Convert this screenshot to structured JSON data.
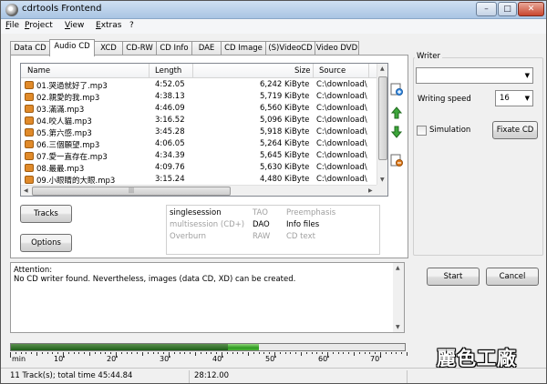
{
  "window": {
    "title": "cdrtools Frontend"
  },
  "menu": [
    "File",
    "Project",
    "View",
    "Extras",
    "?"
  ],
  "tabs": [
    "Data CD",
    "Audio CD",
    "XCD",
    "CD-RW",
    "CD Info",
    "DAE",
    "CD Image",
    "(S)VideoCD",
    "Video DVD"
  ],
  "track_list": {
    "columns": [
      "Name",
      "Length",
      "Size",
      "Source"
    ],
    "rows": [
      {
        "name": "01.哭過就好了.mp3",
        "length": "4:52.05",
        "size": "6,242 KiByte",
        "source": "C:\\download\\"
      },
      {
        "name": "02.親愛的我.mp3",
        "length": "4:38.13",
        "size": "5,719 KiByte",
        "source": "C:\\download\\"
      },
      {
        "name": "03.滿滿.mp3",
        "length": "4:46.09",
        "size": "6,560 KiByte",
        "source": "C:\\download\\"
      },
      {
        "name": "04.咬人貓.mp3",
        "length": "3:16.52",
        "size": "5,096 KiByte",
        "source": "C:\\download\\"
      },
      {
        "name": "05.第六感.mp3",
        "length": "3:45.28",
        "size": "5,918 KiByte",
        "source": "C:\\download\\"
      },
      {
        "name": "06.三個願望.mp3",
        "length": "4:06.05",
        "size": "5,264 KiByte",
        "source": "C:\\download\\"
      },
      {
        "name": "07.愛一直存在.mp3",
        "length": "4:34.39",
        "size": "5,645 KiByte",
        "source": "C:\\download\\"
      },
      {
        "name": "08.最最.mp3",
        "length": "4:09.76",
        "size": "5,630 KiByte",
        "source": "C:\\download\\"
      },
      {
        "name": "09.小眼睛的大眼.mp3",
        "length": "3:15.24",
        "size": "4,480 KiByte",
        "source": "C:\\download\\"
      }
    ]
  },
  "buttons": {
    "tracks": "Tracks",
    "options": "Options",
    "fixate": "Fixate CD",
    "start": "Start",
    "cancel": "Cancel"
  },
  "options_grid": {
    "col1": [
      "singlesession",
      "multisession (CD+)",
      "Overburn"
    ],
    "col2": [
      "TAO",
      "DAO",
      "RAW"
    ],
    "col3": [
      "Preemphasis",
      "Info files",
      "CD text"
    ],
    "active": {
      "col1": [
        true,
        false,
        false
      ],
      "col2": [
        false,
        true,
        false
      ],
      "col3": [
        false,
        true,
        false
      ]
    }
  },
  "writer": {
    "label": "Writer",
    "selected": "",
    "speed_label": "Writing speed",
    "speed": "16",
    "simulation_label": "Simulation",
    "simulation_checked": false
  },
  "log": {
    "line1": "Attention:",
    "line2": "No CD writer found. Nevertheless, images (data CD, XD) can be created."
  },
  "capacity": {
    "scale_labels": [
      "min",
      "10'",
      "20'",
      "30'",
      "40'",
      "50'",
      "60'",
      "70'"
    ],
    "used_fraction": 0.63,
    "dark_fraction": 0.55
  },
  "status": {
    "left": "11 Track(s); total time 45:44.84",
    "right": "28:12.00"
  },
  "watermark": "麗色工廠",
  "colors": {
    "accent_blue": "#a9c4e3",
    "progress_green": "#2f9a22"
  }
}
